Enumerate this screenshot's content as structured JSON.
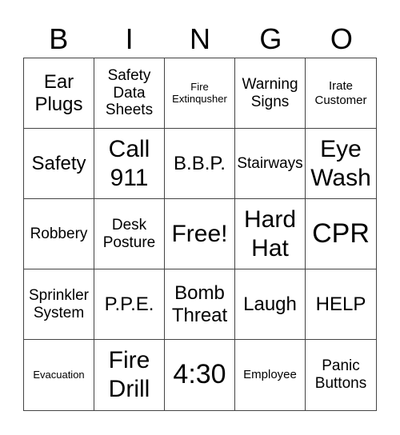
{
  "header": [
    "B",
    "I",
    "N",
    "G",
    "O"
  ],
  "cells": [
    [
      "Ear Plugs",
      "Safety Data Sheets",
      "Fire Extinqusher",
      "Warning Signs",
      "Irate Customer"
    ],
    [
      "Safety",
      "Call 911",
      "B.B.P.",
      "Stairways",
      "Eye Wash"
    ],
    [
      "Robbery",
      "Desk Posture",
      "Free!",
      "Hard Hat",
      "CPR"
    ],
    [
      "Sprinkler System",
      "P.P.E.",
      "Bomb Threat",
      "Laugh",
      "HELP"
    ],
    [
      "Evacuation",
      "Fire Drill",
      "4:30",
      "Employee",
      "Panic Buttons"
    ]
  ]
}
